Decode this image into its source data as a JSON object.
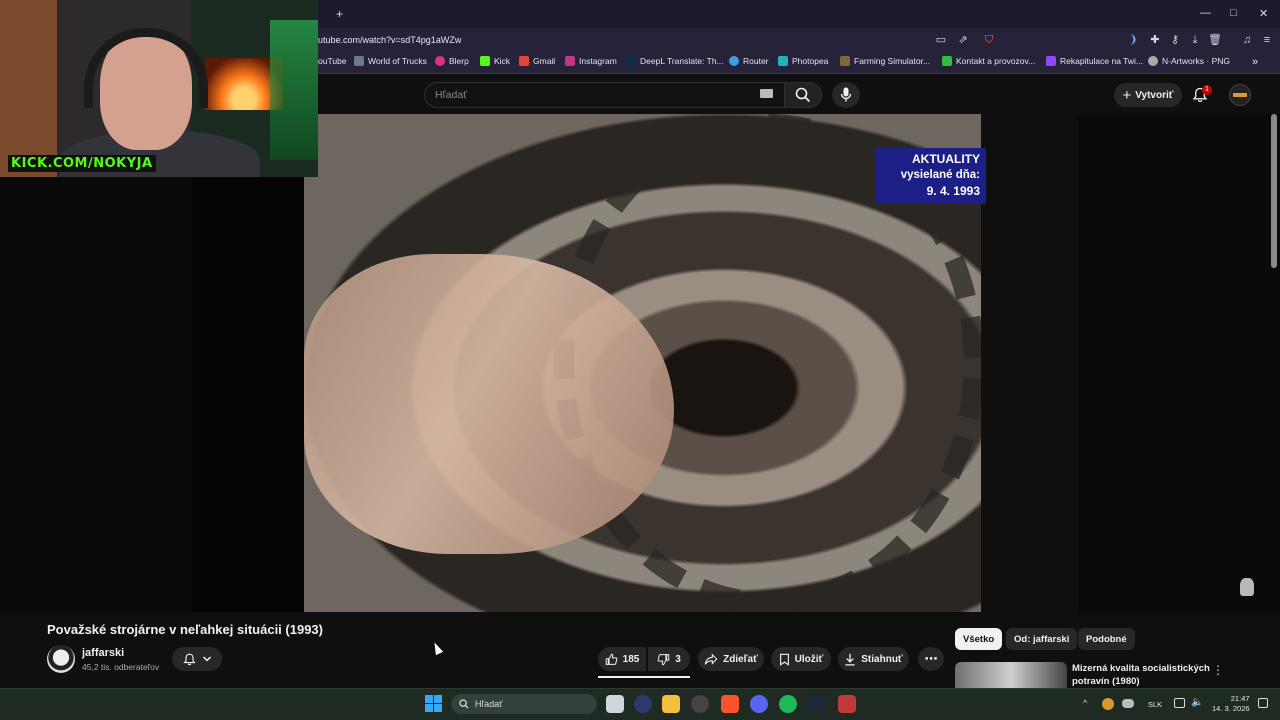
{
  "browser": {
    "url": "utube.com/watch?v=sdT4pg1aWZw",
    "new_tab": "+",
    "win_min": "—",
    "win_max": "□",
    "win_close": "✕",
    "bookmarks": [
      "ouTube",
      "World of Trucks",
      "Blerp",
      "Kick",
      "Gmail",
      "Instagram",
      "DeepL Translate: Th...",
      "Router",
      "Photopea",
      "Farming Simulator...",
      "Kontakt a provozov...",
      "Rekapitulace na Twi...",
      "N-Artworks · PNG"
    ],
    "bookmarks_more": "»"
  },
  "webcam": {
    "tag": "KICK.COM/NOKYJA"
  },
  "youtube": {
    "search_placeholder": "Hľadať",
    "create_label": "Vytvoriť",
    "notification_count": "1",
    "video_overlay": {
      "line1": "AKTUALITY",
      "line2": "vysielané dňa:",
      "line3": "9. 4. 1993"
    },
    "video_title": "Považské strojárne v neľahkej situácii (1993)",
    "channel_name": "jaffarski",
    "subscribers": "45,2 tis. odberateľov",
    "likes": "185",
    "dislikes": "3",
    "share_label": "Zdieľať",
    "save_label": "Uložiť",
    "download_label": "Stiahnuť",
    "more_label": "⋯",
    "chips": [
      "Všetko",
      "Od: jaffarski",
      "Podobné"
    ],
    "recommendation_title": "Mizerná kvalita socialistických potravín (1980)"
  },
  "taskbar": {
    "search_placeholder": "Hľadať",
    "language": "SLK",
    "time": "21:47",
    "date": "14. 3. 2026"
  },
  "colors": {
    "youtube_bg": "#0f0f0f",
    "kick_green": "#53fc18",
    "news_blue": "#1c1f86",
    "notification_red": "#cc0000"
  }
}
